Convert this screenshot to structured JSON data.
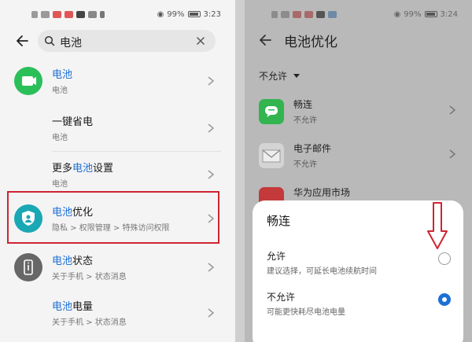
{
  "colors": {
    "accent": "#1c6fd6",
    "highlight_box": "#cf2430"
  },
  "left": {
    "status": {
      "battery": "99%",
      "time": "3:23"
    },
    "search": {
      "query": "电池"
    },
    "results": [
      {
        "title_hl": "电池",
        "title_rest": "",
        "subtitle": "电池",
        "icon": "battery-green-icon"
      },
      {
        "title_pre": "一键省电",
        "title_hl": "",
        "title_rest": "",
        "subtitle": "电池",
        "icon": ""
      },
      {
        "title_pre": "更多",
        "title_hl": "电池",
        "title_rest": "设置",
        "subtitle": "电池",
        "icon": ""
      },
      {
        "title_hl": "电池",
        "title_rest": "优化",
        "subtitle": "隐私 > 权限管理 > 特殊访问权限",
        "icon": "shield-teal-icon"
      },
      {
        "title_hl": "电池",
        "title_rest": "状态",
        "subtitle": "关于手机 > 状态消息",
        "icon": "phone-info-icon"
      },
      {
        "title_hl": "电池",
        "title_rest": "电量",
        "subtitle": "关于手机 > 状态消息",
        "icon": ""
      }
    ]
  },
  "right": {
    "status": {
      "battery": "99%",
      "time": "3:24"
    },
    "title": "电池优化",
    "filter": "不允许",
    "apps": [
      {
        "name": "畅连",
        "status": "不允许",
        "icon": "changlian-icon"
      },
      {
        "name": "电子邮件",
        "status": "不允许",
        "icon": "email-icon"
      },
      {
        "name": "华为应用市场",
        "status": "",
        "icon": "appgallery-icon"
      }
    ],
    "sheet": {
      "title": "畅连",
      "options": [
        {
          "label": "允许",
          "desc": "建议选择，可延长电池续航时间",
          "selected": false
        },
        {
          "label": "不允许",
          "desc": "可能更快耗尽电池电量",
          "selected": true
        }
      ]
    }
  }
}
